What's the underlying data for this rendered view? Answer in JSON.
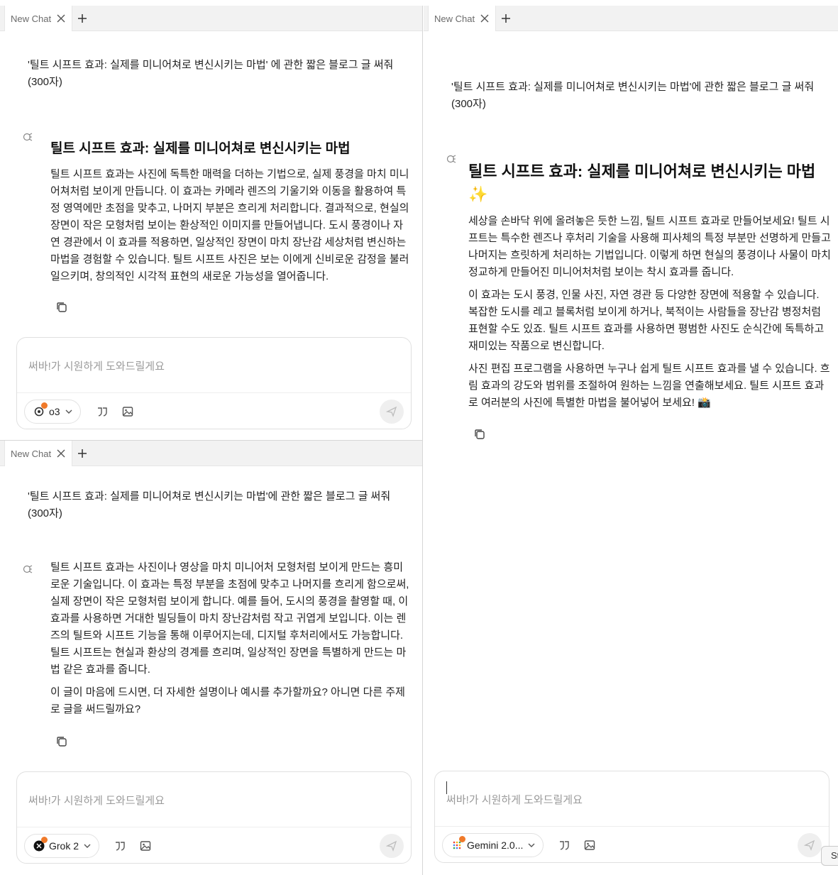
{
  "panes": {
    "top_left": {
      "tab_title": "New Chat",
      "user_message": "'틸트 시프트 효과: 실제를 미니어쳐로 변신시키는 마법' 에 관한 짧은 블로그 글 써줘 (300자)",
      "bot_title": "틸트 시프트 효과: 실제를 미니어쳐로 변신시키는 마법",
      "bot_paragraphs": [
        "틸트 시프트 효과는 사진에 독특한 매력을 더하는 기법으로, 실제 풍경을 마치 미니어쳐처럼 보이게 만듭니다. 이 효과는 카메라 렌즈의 기울기와 이동을 활용하여 특정 영역에만 초점을 맞추고, 나머지 부분은 흐리게 처리합니다. 결과적으로, 현실의 장면이 작은 모형처럼 보이는 환상적인 이미지를 만들어냅니다. 도시 풍경이나 자연 경관에서 이 효과를 적용하면, 일상적인 장면이 마치 장난감 세상처럼 변신하는 마법을 경험할 수 있습니다. 틸트 시프트 사진은 보는 이에게 신비로운 감정을 불러일으키며, 창의적인 시각적 표현의 새로운 가능성을 열어줍니다."
      ],
      "composer_placeholder": "써바!가 시원하게 도와드릴게요",
      "model_name": "o3"
    },
    "bottom_left": {
      "tab_title": "New Chat",
      "user_message": "'틸트 시프트 효과: 실제를 미니어쳐로 변신시키는 마법'에 관한 짧은 블로그 글 써줘 (300자)",
      "bot_paragraphs": [
        "틸트 시프트 효과는 사진이나 영상을 마치 미니어처 모형처럼 보이게 만드는 흥미로운 기술입니다. 이 효과는 특정 부분을 초점에 맞추고 나머지를 흐리게 함으로써, 실제 장면이 작은 모형처럼 보이게 합니다. 예를 들어, 도시의 풍경을 촬영할 때, 이 효과를 사용하면 거대한 빌딩들이 마치 장난감처럼 작고 귀엽게 보입니다. 이는 렌즈의 틸트와 시프트 기능을 통해 이루어지는데, 디지털 후처리에서도 가능합니다. 틸트 시프트는 현실과 환상의 경계를 흐리며, 일상적인 장면을 특별하게 만드는 마법 같은 효과를 줍니다.",
        "이 글이 마음에 드시면, 더 자세한 설명이나 예시를 추가할까요? 아니면 다른 주제로 글을 써드릴까요?"
      ],
      "composer_placeholder": "써바!가 시원하게 도와드릴게요",
      "model_name": "Grok 2"
    },
    "right": {
      "tab_title": "New Chat",
      "user_message": "'틸트 시프트 효과: 실제를 미니어쳐로 변신시키는 마법'에 관한 짧은 블로그 글 써줘 (300자)",
      "bot_title": "틸트 시프트 효과: 실제를 미니어쳐로 변신시키는 마법 ✨",
      "bot_paragraphs": [
        "세상을 손바닥 위에 올려놓은 듯한 느낌, 틸트 시프트 효과로 만들어보세요! 틸트 시프트는 특수한 렌즈나 후처리 기술을 사용해 피사체의 특정 부분만 선명하게 만들고 나머지는 흐릿하게 처리하는 기법입니다. 이렇게 하면 현실의 풍경이나 사물이 마치 정교하게 만들어진 미니어처처럼 보이는 착시 효과를 줍니다.",
        "이 효과는 도시 풍경, 인물 사진, 자연 경관 등 다양한 장면에 적용할 수 있습니다. 복잡한 도시를 레고 블록처럼 보이게 하거나, 북적이는 사람들을 장난감 병정처럼 표현할 수도 있죠. 틸트 시프트 효과를 사용하면 평범한 사진도 순식간에 독특하고 재미있는 작품으로 변신합니다.",
        "사진 편집 프로그램을 사용하면 누구나 쉽게 틸트 시프트 효과를 낼 수 있습니다. 흐림 효과의 강도와 범위를 조절하여 원하는 느낌을 연출해보세요. 틸트 시프트 효과로 여러분의 사진에 특별한 마법을 불어넣어 보세요! 📸"
      ],
      "composer_placeholder": "써바!가 시원하게 도와드릴게요",
      "model_name": "Gemini 2.0..."
    }
  },
  "floating_button_label": "St",
  "colors": {
    "model_badge": "#f07a2a",
    "tab_bar": "#f2f2f2",
    "border": "#e0e0e0"
  },
  "icons": {
    "tab_close": "close-icon",
    "tab_add": "plus-icon",
    "bot_avatar": "bot-avatar-icon",
    "copy": "copy-icon",
    "quote": "quote-icon",
    "image": "image-icon",
    "send": "send-icon",
    "dropdown": "chevron-down-icon"
  }
}
